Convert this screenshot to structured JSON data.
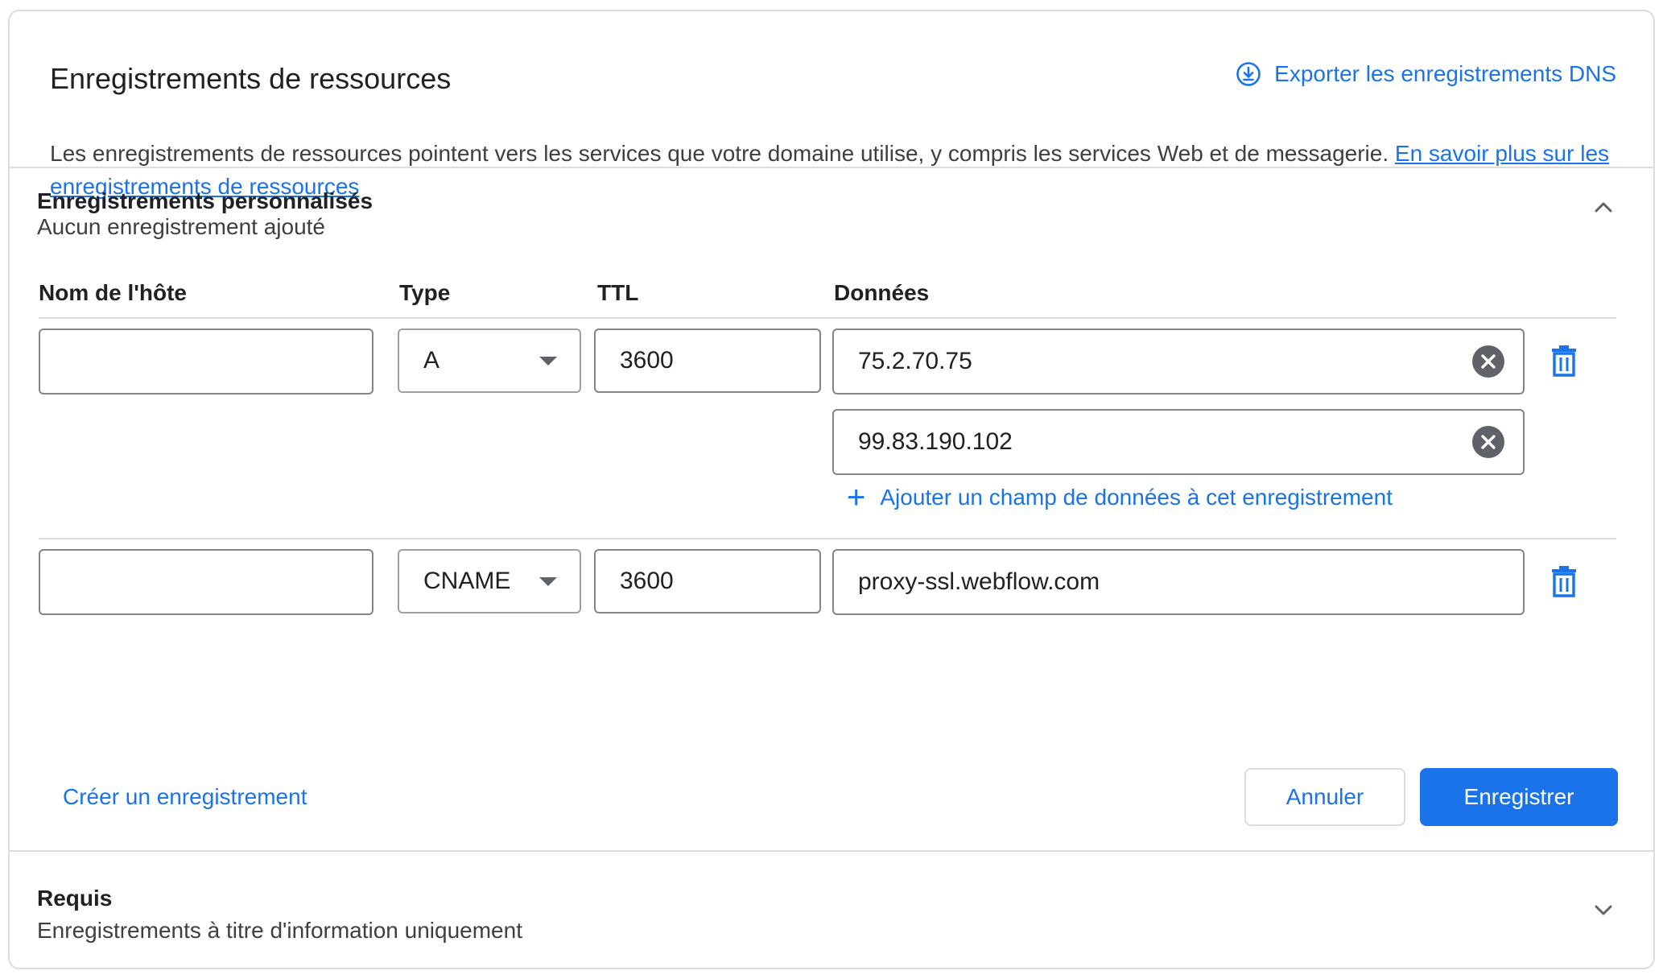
{
  "header": {
    "title": "Enregistrements de ressources",
    "export_label": "Exporter les enregistrements DNS"
  },
  "description": {
    "text": "Les enregistrements de ressources pointent vers les services que votre domaine utilise, y compris les services Web et de messagerie. ",
    "link_text": "En savoir plus sur les enregistrements de ressources"
  },
  "custom_section": {
    "title": "Enregistrements personnalisés",
    "subtitle": "Aucun enregistrement ajouté",
    "expanded": true,
    "columns": {
      "host": "Nom de l'hôte",
      "type": "Type",
      "ttl": "TTL",
      "data": "Données"
    },
    "records": [
      {
        "host": "",
        "type": "A",
        "ttl": "3600",
        "data": [
          "75.2.70.75",
          "99.83.190.102"
        ],
        "add_data_label": "Ajouter un champ de données à cet enregistrement"
      },
      {
        "host": "",
        "type": "CNAME",
        "ttl": "3600",
        "data": [
          "proxy-ssl.webflow.com"
        ]
      }
    ],
    "create_label": "Créer un enregistrement",
    "cancel_label": "Annuler",
    "save_label": "Enregistrer"
  },
  "required_section": {
    "title": "Requis",
    "subtitle": "Enregistrements à titre d'information uniquement",
    "expanded": false
  },
  "colors": {
    "accent": "#1a73e8",
    "border": "#dadce0",
    "text": "#202124",
    "icon_gray": "#5f6368"
  },
  "icons": {
    "export": "download-circle-icon",
    "collapse": "chevron-up-icon",
    "expand": "chevron-down-icon",
    "clear": "cancel-circle-icon",
    "delete": "trash-icon",
    "add": "plus-icon"
  }
}
